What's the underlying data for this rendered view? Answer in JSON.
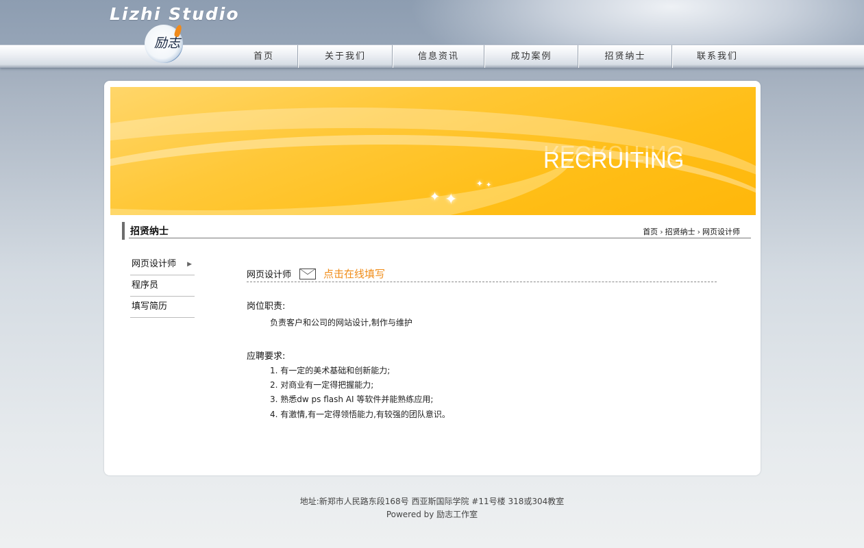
{
  "header": {
    "brand": "Lizhi Studio",
    "logo_text": "励志"
  },
  "nav": {
    "items": [
      {
        "label": "首页"
      },
      {
        "label": "关于我们"
      },
      {
        "label": "信息资讯"
      },
      {
        "label": "成功案例"
      },
      {
        "label": "招贤纳士"
      },
      {
        "label": "联系我们"
      }
    ]
  },
  "banner": {
    "title": "RECRUITING"
  },
  "section": {
    "title": "招贤纳士",
    "breadcrumb": [
      "首页",
      "招贤纳士",
      "网页设计师"
    ]
  },
  "sidebar": {
    "items": [
      {
        "label": "网页设计师"
      },
      {
        "label": "程序员"
      },
      {
        "label": "填写简历"
      }
    ]
  },
  "content": {
    "job_title": "网页设计师",
    "fill_link": "点击在线填写",
    "duty_heading": "岗位职责:",
    "duty_text": "负责客户和公司的网站设计,制作与维护",
    "req_heading": "应聘要求:",
    "requirements": [
      "1. 有一定的美术基础和创新能力;",
      "2. 对商业有一定得把握能力;",
      "3. 熟悉dw ps flash AI 等软件并能熟练应用;",
      "4. 有激情,有一定得领悟能力,有较强的团队意识。"
    ]
  },
  "footer": {
    "address": "地址:新郑市人民路东段168号 西亚斯国际学院 #11号楼 318或304教室",
    "powered": "Powered by 励志工作室"
  }
}
